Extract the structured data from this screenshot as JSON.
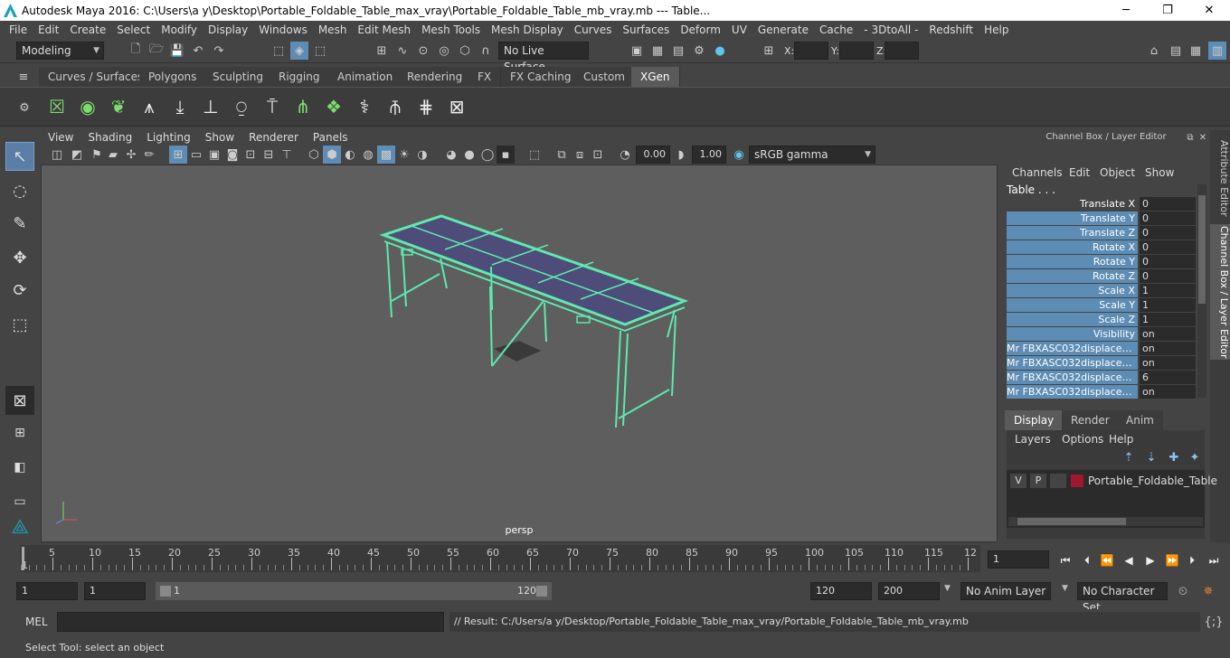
{
  "window": {
    "title": "Autodesk Maya 2016: C:\\Users\\a y\\Desktop\\Portable_Foldable_Table_max_vray\\Portable_Foldable_Table_mb_vray.mb    ---    Table...",
    "minimize": "─",
    "maximize": "❐",
    "close": "✕"
  },
  "menubar": [
    "File",
    "Edit",
    "Create",
    "Select",
    "Modify",
    "Display",
    "Windows",
    "Mesh",
    "Edit Mesh",
    "Mesh Tools",
    "Mesh Display",
    "Curves",
    "Surfaces",
    "Deform",
    "UV",
    "Generate",
    "Cache",
    "- 3DtoAll -",
    "Redshift",
    "Help"
  ],
  "statusline": {
    "mode": "Modeling",
    "live_surface": "No Live Surface",
    "x_label": "X:",
    "y_label": "Y:",
    "z_label": "Z:"
  },
  "shelf_tabs": [
    "Curves / Surfaces",
    "Polygons",
    "Sculpting",
    "Rigging",
    "Animation",
    "Rendering",
    "FX",
    "FX Caching",
    "Custom",
    "XGen"
  ],
  "viewport": {
    "menu": [
      "View",
      "Shading",
      "Lighting",
      "Show",
      "Renderer",
      "Panels"
    ],
    "exposure": "0.00",
    "gamma": "1.00",
    "color_space": "sRGB gamma",
    "camera": "persp"
  },
  "channel_box": {
    "title": "Channel Box / Layer Editor",
    "menu": [
      "Channels",
      "Edit",
      "Object",
      "Show"
    ],
    "object": "Table . . .",
    "channels": [
      {
        "name": "Translate X",
        "value": "0"
      },
      {
        "name": "Translate Y",
        "value": "0"
      },
      {
        "name": "Translate Z",
        "value": "0"
      },
      {
        "name": "Rotate X",
        "value": "0"
      },
      {
        "name": "Rotate Y",
        "value": "0"
      },
      {
        "name": "Rotate Z",
        "value": "0"
      },
      {
        "name": "Scale X",
        "value": "1"
      },
      {
        "name": "Scale Y",
        "value": "1"
      },
      {
        "name": "Scale Z",
        "value": "1"
      },
      {
        "name": "Visibility",
        "value": "on"
      },
      {
        "name": "Mr FBXASC032displaceme...",
        "value": "on"
      },
      {
        "name": "Mr FBXASC032displaceme...",
        "value": "on"
      },
      {
        "name": "Mr FBXASC032displaceme...",
        "value": "6"
      },
      {
        "name": "Mr FBXASC032displaceme...",
        "value": "on"
      }
    ]
  },
  "side_tabs": {
    "attribute_editor": "Attribute Editor",
    "channel_box": "Channel Box / Layer Editor"
  },
  "layer_editor": {
    "tabs": [
      "Display",
      "Render",
      "Anim"
    ],
    "menu": [
      "Layers",
      "Options",
      "Help"
    ],
    "layer": {
      "v": "V",
      "p": "P",
      "name": "Portable_Foldable_Table",
      "color": "#a01830"
    }
  },
  "timeline": {
    "ticks": [
      "5",
      "10",
      "15",
      "20",
      "25",
      "30",
      "35",
      "40",
      "45",
      "50",
      "55",
      "60",
      "65",
      "70",
      "75",
      "80",
      "85",
      "90",
      "95",
      "100",
      "105",
      "110",
      "115",
      "12"
    ],
    "start_marker": "1",
    "current_frame": "1"
  },
  "range": {
    "start": "1",
    "playback_start": "1",
    "slider_start": "1",
    "slider_end": "120",
    "playback_end": "120",
    "end": "200",
    "anim_layer": "No Anim Layer",
    "character_set": "No Character Set"
  },
  "mel": {
    "label": "MEL",
    "result": "// Result: C:/Users/a y/Desktop/Portable_Foldable_Table_max_vray/Portable_Foldable_Table_mb_vray.mb"
  },
  "help_line": "Select Tool: select an object",
  "colors": {
    "wireframe": "#5fe8b0",
    "channel_label": "#5d8cb5",
    "active_tab": "#5a5a5a"
  }
}
